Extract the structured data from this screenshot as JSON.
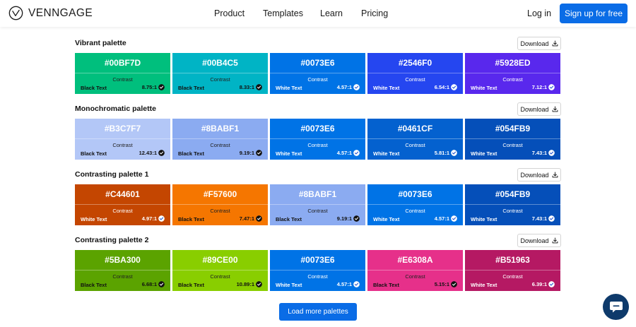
{
  "brand": {
    "name": "VENNGAGE",
    "logo_icon": "venngage-logo-icon"
  },
  "nav": {
    "links": [
      "Product",
      "Templates",
      "Learn",
      "Pricing"
    ],
    "login": "Log in",
    "signup": "Sign up for free"
  },
  "colors": {
    "accent": "#0A6CE6",
    "chat_bubble": "#0E3A6B"
  },
  "palettes": [
    {
      "title": "Vibrant palette",
      "download": "Download",
      "swatches": [
        {
          "hex": "#00BF7D",
          "contrast_label": "Contrast",
          "text": "Black Text",
          "ratio": "8.75:1",
          "tone": "dark"
        },
        {
          "hex": "#00B4C5",
          "contrast_label": "Contrast",
          "text": "Black Text",
          "ratio": "8.33:1",
          "tone": "dark"
        },
        {
          "hex": "#0073E6",
          "contrast_label": "Contrast",
          "text": "White Text",
          "ratio": "4.57:1",
          "tone": "light"
        },
        {
          "hex": "#2546F0",
          "contrast_label": "Contrast",
          "text": "White Text",
          "ratio": "6.54:1",
          "tone": "light"
        },
        {
          "hex": "#5928ED",
          "contrast_label": "Contrast",
          "text": "White Text",
          "ratio": "7.12:1",
          "tone": "light"
        }
      ]
    },
    {
      "title": "Monochromatic palette",
      "download": "Download",
      "swatches": [
        {
          "hex": "#B3C7F7",
          "contrast_label": "Contrast",
          "text": "Black Text",
          "ratio": "12.43:1",
          "tone": "dark"
        },
        {
          "hex": "#8BABF1",
          "contrast_label": "Contrast",
          "text": "Black Text",
          "ratio": "9.19:1",
          "tone": "dark"
        },
        {
          "hex": "#0073E6",
          "contrast_label": "Contrast",
          "text": "White Text",
          "ratio": "4.57:1",
          "tone": "light"
        },
        {
          "hex": "#0461CF",
          "contrast_label": "Contrast",
          "text": "White Text",
          "ratio": "5.81:1",
          "tone": "light"
        },
        {
          "hex": "#054FB9",
          "contrast_label": "Contrast",
          "text": "White Text",
          "ratio": "7.43:1",
          "tone": "light"
        }
      ]
    },
    {
      "title": "Contrasting palette 1",
      "download": "Download",
      "swatches": [
        {
          "hex": "#C44601",
          "contrast_label": "Contrast",
          "text": "White Text",
          "ratio": "4.97:1",
          "tone": "light"
        },
        {
          "hex": "#F57600",
          "contrast_label": "Contrast",
          "text": "Black Text",
          "ratio": "7.47:1",
          "tone": "dark"
        },
        {
          "hex": "#8BABF1",
          "contrast_label": "Contrast",
          "text": "Black Text",
          "ratio": "9.19:1",
          "tone": "dark"
        },
        {
          "hex": "#0073E6",
          "contrast_label": "Contrast",
          "text": "White Text",
          "ratio": "4.57:1",
          "tone": "light"
        },
        {
          "hex": "#054FB9",
          "contrast_label": "Contrast",
          "text": "White Text",
          "ratio": "7.43:1",
          "tone": "light"
        }
      ]
    },
    {
      "title": "Contrasting palette 2",
      "download": "Download",
      "swatches": [
        {
          "hex": "#5BA300",
          "contrast_label": "Contrast",
          "text": "Black Text",
          "ratio": "6.68:1",
          "tone": "dark"
        },
        {
          "hex": "#89CE00",
          "contrast_label": "Contrast",
          "text": "Black Text",
          "ratio": "10.89:1",
          "tone": "dark"
        },
        {
          "hex": "#0073E6",
          "contrast_label": "Contrast",
          "text": "White Text",
          "ratio": "4.57:1",
          "tone": "light"
        },
        {
          "hex": "#E6308A",
          "contrast_label": "Contrast",
          "text": "Black Text",
          "ratio": "5.15:1",
          "tone": "dark"
        },
        {
          "hex": "#B51963",
          "contrast_label": "Contrast",
          "text": "White Text",
          "ratio": "6.39:1",
          "tone": "light"
        }
      ]
    }
  ],
  "load_more": "Load more palettes",
  "icons": {
    "download": "download-icon",
    "check": "check-circle-icon",
    "chat": "chat-bubble-icon"
  }
}
